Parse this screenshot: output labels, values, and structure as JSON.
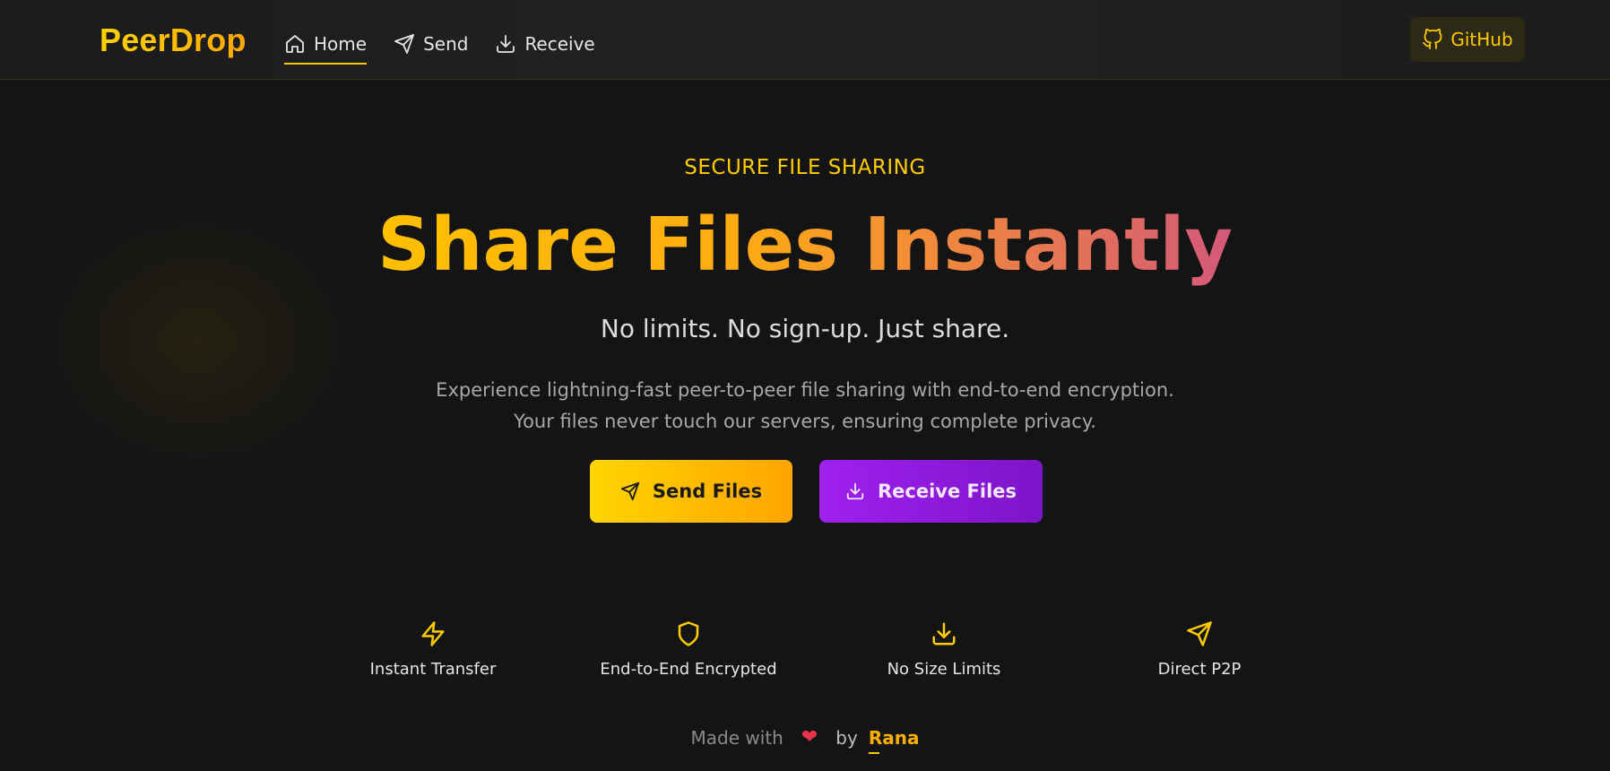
{
  "brand": "PeerDrop",
  "nav": {
    "home": "Home",
    "send": "Send",
    "receive": "Receive",
    "github": "GitHub"
  },
  "hero": {
    "eyebrow": "SECURE FILE SHARING",
    "title": "Share Files Instantly",
    "tagline": "No limits. No sign-up. Just share.",
    "description": "Experience lightning-fast peer-to-peer file sharing with end-to-end encryption. Your files never touch our servers, ensuring complete privacy.",
    "send_button": "Send Files",
    "receive_button": "Receive Files"
  },
  "features": [
    {
      "label": "Instant Transfer",
      "icon": "lightning-icon"
    },
    {
      "label": "End-to-End Encrypted",
      "icon": "shield-icon"
    },
    {
      "label": "No Size Limits",
      "icon": "download-icon"
    },
    {
      "label": "Direct P2P",
      "icon": "send-icon"
    }
  ],
  "footer": {
    "made_with": "Made with",
    "heart": "❤",
    "by": "by",
    "author": "Rana"
  },
  "colors": {
    "accent": "#ffcc00",
    "accent_orange": "#ffa500",
    "purple": "#a020f0",
    "background": "#141414"
  }
}
